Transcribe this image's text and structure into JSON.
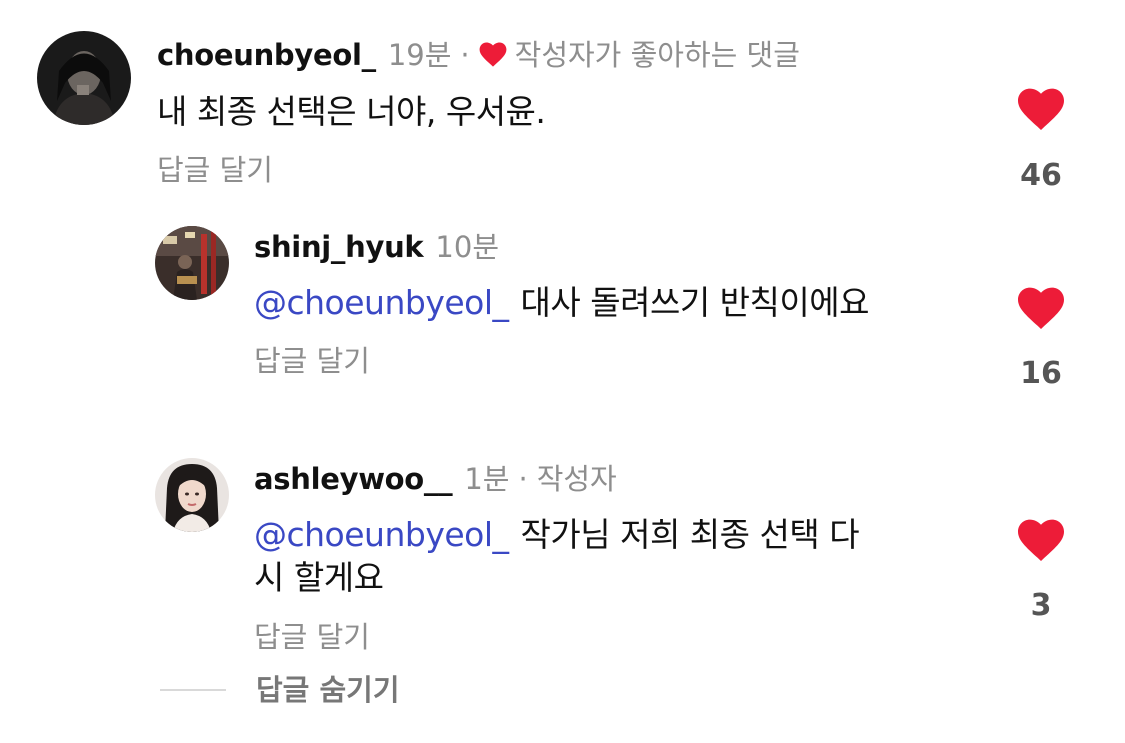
{
  "comments": [
    {
      "username": "choeunbyeol_",
      "time": "19분",
      "liked_by_creator_label": "작성자가 좋아하는 댓글",
      "mention": "",
      "text": "내 최종 선택은 너야, 우서윤.",
      "reply_label": "답글 달기",
      "likes": "46"
    },
    {
      "username": "shinj_hyuk",
      "time": "10분",
      "mention": "@choeunbyeol_",
      "text": "대사 돌려쓰기 반칙이에요",
      "reply_label": "답글 달기",
      "likes": "16"
    },
    {
      "username": "ashleywoo__",
      "time": "1분",
      "creator_label": "작성자",
      "mention": "@choeunbyeol_",
      "text_line1": "작가님 저희 최종 선택 다",
      "text_line2": "시 할게요",
      "reply_label": "답글 달기",
      "likes": "3"
    }
  ],
  "hide_replies_label": "답글 숨기기",
  "separator": "·",
  "colors": {
    "heart": "#ed4956",
    "mention": "#3a48c4",
    "secondary_text": "#8e8e8e"
  },
  "icons": {
    "like": "heart-filled-icon",
    "creator_like": "heart-small-icon"
  }
}
